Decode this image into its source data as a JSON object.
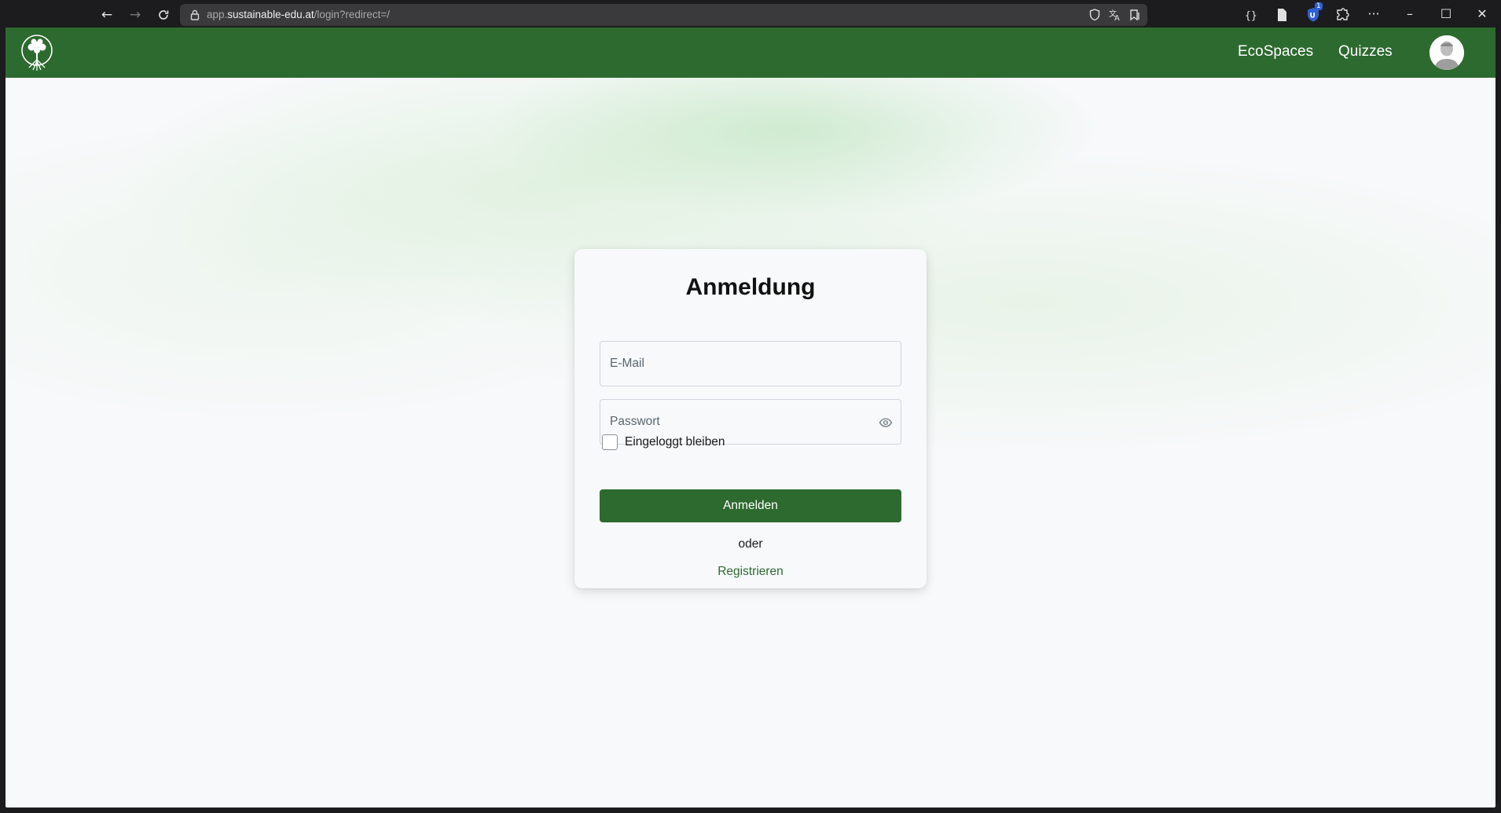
{
  "browser": {
    "url_host": "app.sustainable-edu.at",
    "url_prefix": "app.",
    "url_domain": "sustainable-edu.at",
    "url_path": "/login?redirect=/",
    "extension_badge": "1"
  },
  "app": {
    "nav": {
      "ecospaces_label": "EcoSpaces",
      "quizzes_label": "Quizzes"
    },
    "brand_color": "#2d6a2f"
  },
  "login": {
    "title": "Anmeldung",
    "email_placeholder": "E-Mail",
    "password_placeholder": "Passwort",
    "remember_label": "Eingeloggt bleiben",
    "remember_checked": false,
    "submit_label": "Anmelden",
    "separator": "oder",
    "register_label": "Registrieren"
  }
}
